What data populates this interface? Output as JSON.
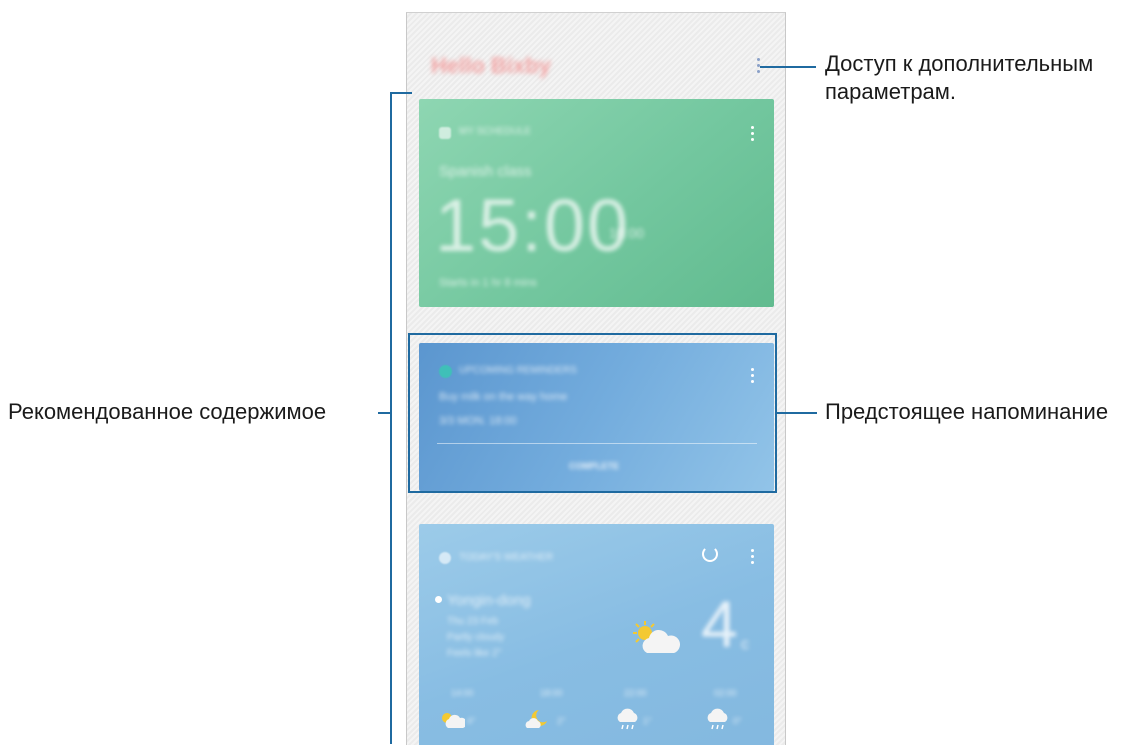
{
  "annotations": {
    "more_options": "Доступ к дополнительным параметрам.",
    "recommended_content": "Рекомендованное содержимое",
    "upcoming_reminder": "Предстоящее напоминание"
  },
  "app": {
    "title": "Hello Bixby"
  },
  "cards": {
    "schedule": {
      "header": "MY SCHEDULE",
      "subtitle": "Spanish class",
      "time": "15:00",
      "time_end": "16:00",
      "footer": "Starts in 1 hr 8 mins"
    },
    "reminder": {
      "header": "UPCOMING REMINDERS",
      "text": "Buy milk on the way home",
      "datetime": "3/3 MON. 18:00",
      "action": "COMPLETE"
    },
    "weather": {
      "header": "TODAY'S WEATHER",
      "city": "Yongin-dong",
      "line1": "Thu 23 Feb",
      "line2": "Partly cloudy",
      "line3": "Feels like 2°",
      "temperature": "4",
      "unit": "c",
      "hours": [
        "14:00",
        "18:00",
        "22:00",
        "02:00"
      ],
      "hour_temps": [
        "4°",
        "2°",
        "1°",
        "0°"
      ],
      "hour_icons": [
        "sun-cloud-icon",
        "moon-cloud-icon",
        "rain-icon",
        "rain-icon"
      ]
    }
  }
}
